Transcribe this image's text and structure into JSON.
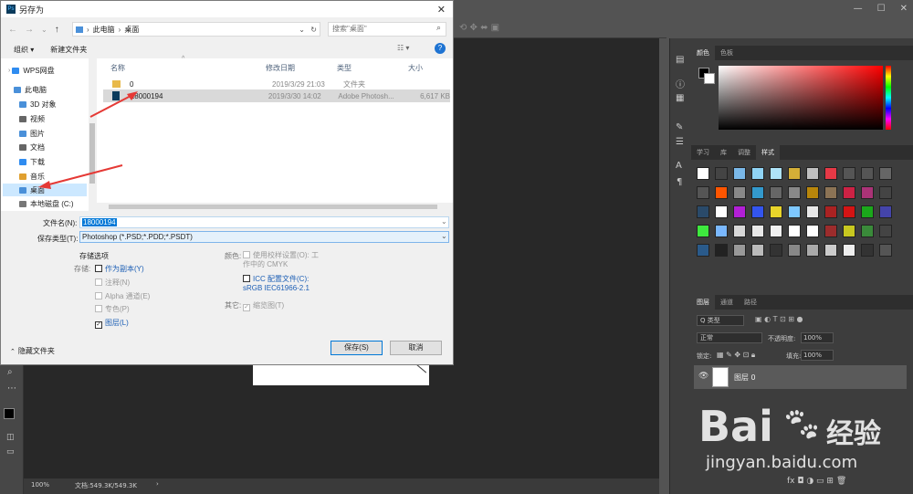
{
  "dialog": {
    "title": "另存为",
    "close": "✕",
    "address": {
      "pc": "此电脑",
      "sep": "›",
      "folder": "桌面"
    },
    "search_placeholder": "搜索\"桌面\"",
    "toolbar": {
      "organize": "组织 ▾",
      "new_folder": "新建文件夹",
      "help": "?"
    },
    "nav_tree": [
      {
        "label": "WPS网盘",
        "color": "#2f8cf0"
      },
      {
        "label": "此电脑",
        "color": "#4a90d9"
      },
      {
        "label": "3D 对象",
        "color": "#4a90d9"
      },
      {
        "label": "视频",
        "color": "#666"
      },
      {
        "label": "图片",
        "color": "#4a90d9"
      },
      {
        "label": "文档",
        "color": "#666"
      },
      {
        "label": "下载",
        "color": "#2f8cf0"
      },
      {
        "label": "音乐",
        "color": "#e0a030"
      },
      {
        "label": "桌面",
        "color": "#4a90d9"
      },
      {
        "label": "本地磁盘 (C:)",
        "color": "#777"
      }
    ],
    "columns": {
      "name": "名称",
      "date": "修改日期",
      "type": "类型",
      "size": "大小"
    },
    "files": [
      {
        "name": "0",
        "date": "2019/3/29 21:03",
        "type": "文件夹",
        "size": ""
      },
      {
        "name": "18000194",
        "date": "2019/3/30 14:02",
        "type": "Adobe Photosh...",
        "size": "6,617 KB"
      }
    ],
    "filename_label": "文件名(N):",
    "filename_value": "18000194",
    "filetype_label": "保存类型(T):",
    "filetype_value": "Photoshop (*.PSD;*.PDD;*.PSDT)",
    "save_options": {
      "heading": "存储选项",
      "store_label": "存储:",
      "as_copy": "作为副本(Y)",
      "notes": "注释(N)",
      "alpha": "Alpha 通道(E)",
      "spot": "专色(P)",
      "layers": "图层(L)",
      "color_label": "颜色:",
      "proof": "使用校样设置(O): 工作中的 CMYK",
      "icc": "ICC 配置文件(C): sRGB IEC61966-2.1",
      "other_label": "其它:",
      "thumbnail": "缩览图(T)"
    },
    "hide_folders": "隐藏文件夹",
    "save_button": "保存(S)",
    "cancel_button": "取消"
  },
  "ps": {
    "right_tabs_color": [
      "颜色",
      "色板"
    ],
    "right_tabs_styles": [
      "学习",
      "库",
      "调整",
      "样式"
    ],
    "layers_tabs": [
      "图层",
      "通道",
      "路径"
    ],
    "layer_filter": "Q 类型",
    "blend_mode": "正常",
    "opacity_label": "不透明度:",
    "opacity_value": "100%",
    "lock_label": "锁定:",
    "fill_label": "填充:",
    "fill_value": "100%",
    "layer_name": "图层 0",
    "zoom": "100%",
    "doc_info": "文档:549.3K/549.3K",
    "watermark_main": "Bai",
    "watermark_brand": "经验",
    "watermark_url": "jingyan.baidu.com"
  },
  "colors": {
    "accent": "#0078d7",
    "arrow": "#e53935",
    "ps_bg": "#535353"
  }
}
